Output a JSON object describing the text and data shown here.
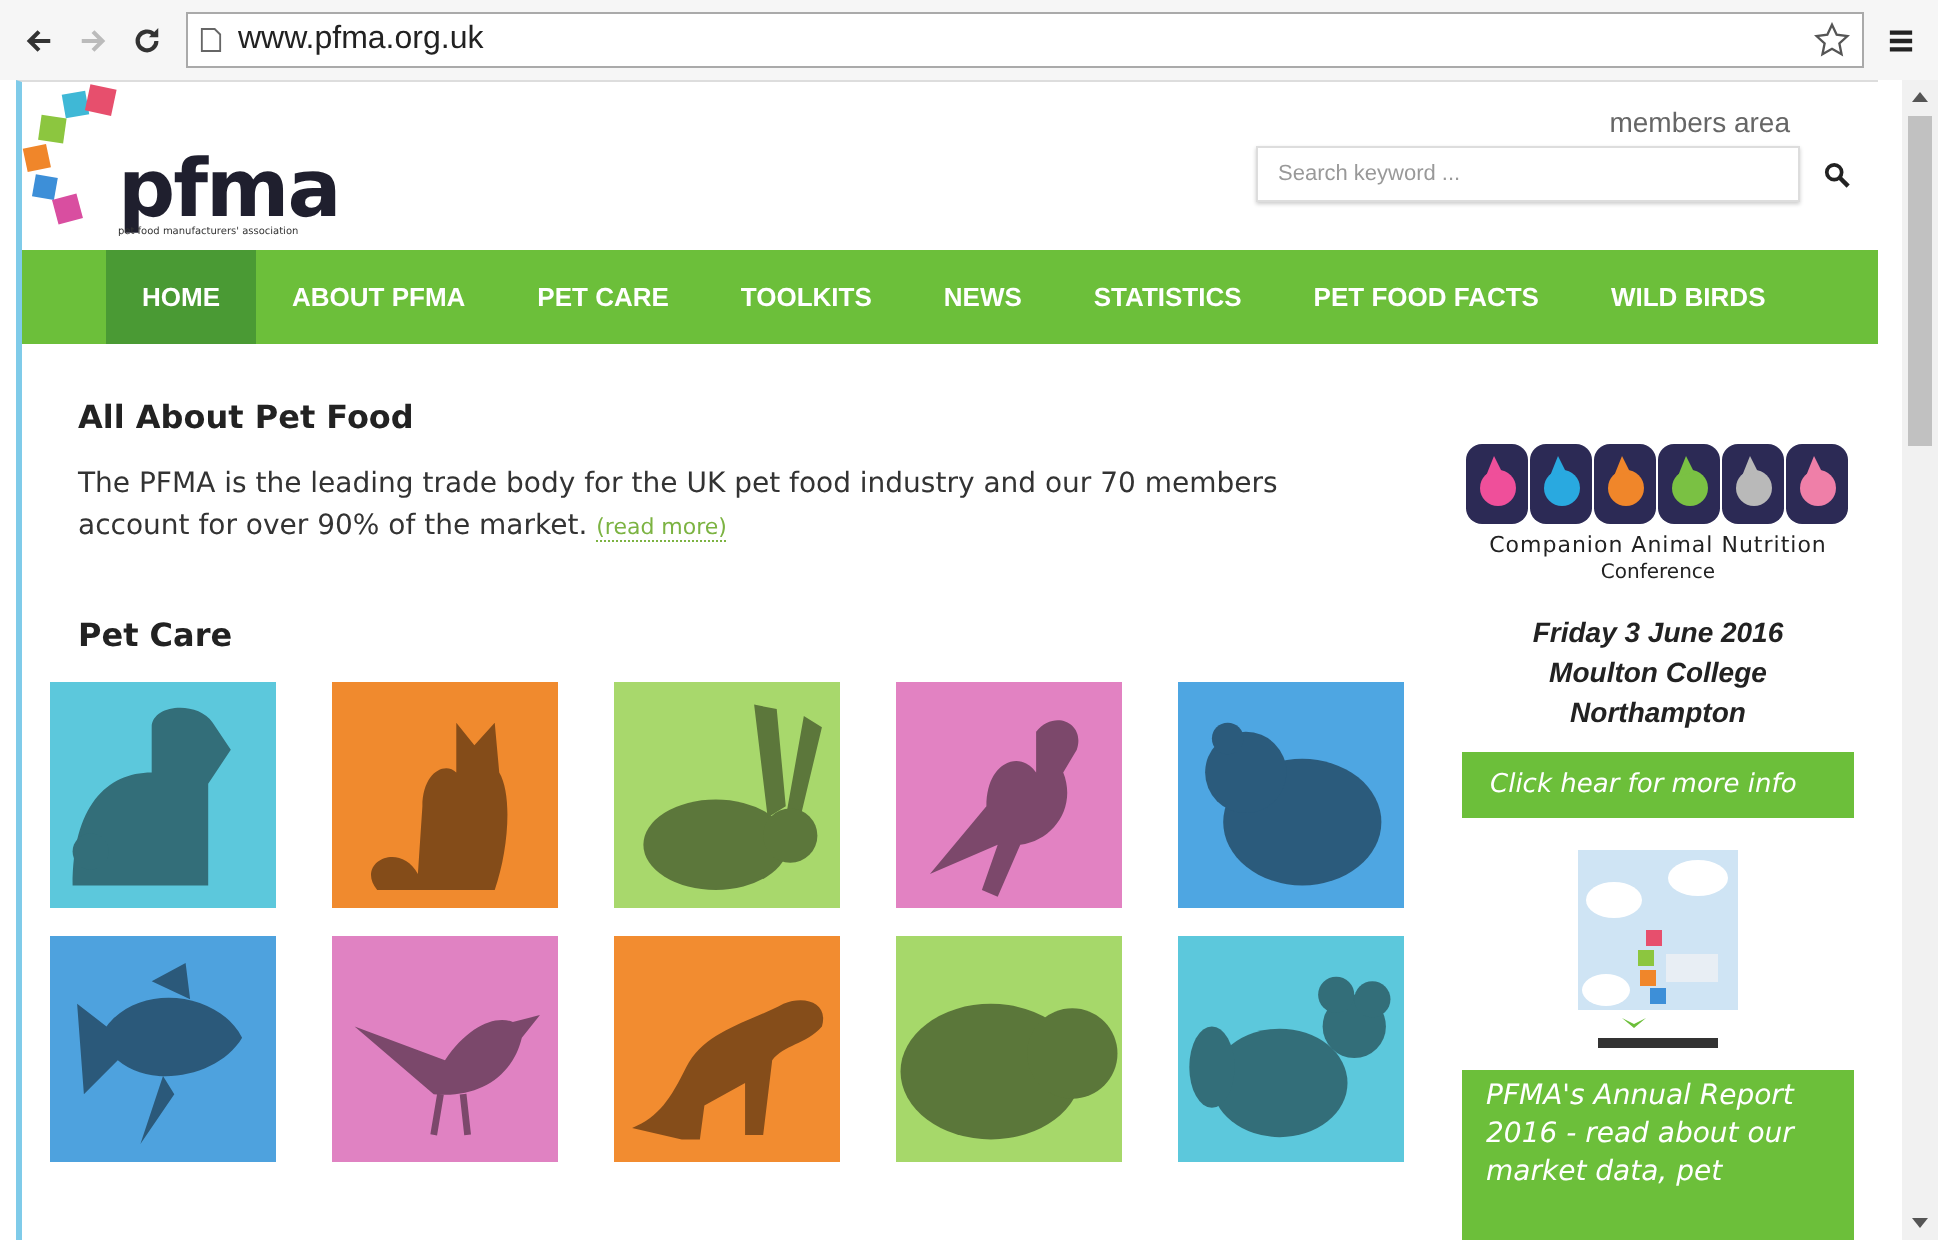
{
  "browser": {
    "url": "www.pfma.org.uk",
    "back_disabled": false,
    "forward_disabled": true
  },
  "header": {
    "logo_text": "pfma",
    "logo_tagline": "pet food manufacturers' association",
    "members_link": "members area",
    "search": {
      "placeholder": "Search keyword ..."
    }
  },
  "nav": [
    {
      "label": "HOME",
      "selected": true
    },
    {
      "label": "ABOUT PFMA",
      "selected": false
    },
    {
      "label": "PET CARE",
      "selected": false
    },
    {
      "label": "TOOLKITS",
      "selected": false
    },
    {
      "label": "NEWS",
      "selected": false
    },
    {
      "label": "STATISTICS",
      "selected": false
    },
    {
      "label": "PET FOOD FACTS",
      "selected": false
    },
    {
      "label": "WILD BIRDS",
      "selected": false
    }
  ],
  "intro": {
    "heading": "All About Pet Food",
    "text": "The PFMA is the leading trade body for the UK pet food industry and our 70 members account for over 90% of the market.",
    "link": "(read more)"
  },
  "pet_care": {
    "heading": "Pet Care",
    "tiles": [
      {
        "color": "#5cc8dc"
      },
      {
        "color": "#f08a2e"
      },
      {
        "color": "#a8d86c"
      },
      {
        "color": "#e282c2"
      },
      {
        "color": "#4ea6e2"
      },
      {
        "color": "#4ea2de"
      },
      {
        "color": "#e082c2"
      },
      {
        "color": "#f28c30"
      },
      {
        "color": "#a6d86a"
      },
      {
        "color": "#5cc8dc"
      }
    ]
  },
  "sidebar": {
    "conference": {
      "title": "Companion Animal Nutrition",
      "subtitle": "Conference",
      "details": [
        "Friday 3 June 2016",
        "Moulton College",
        "Northampton"
      ],
      "button": "Click hear for more info"
    },
    "report": {
      "text": "PFMA's Annual Report 2016 - read about our market data, pet"
    }
  }
}
